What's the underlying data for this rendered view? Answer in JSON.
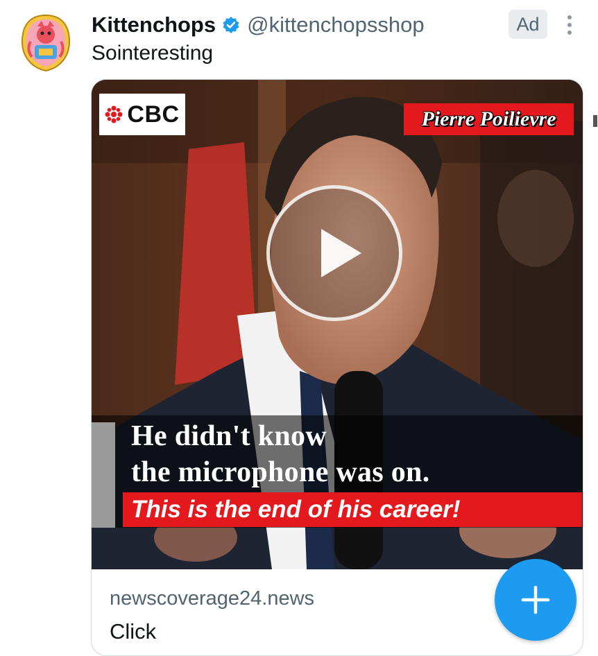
{
  "tweet": {
    "author": {
      "display_name": "Kittenchops",
      "handle": "@kittenchopsshop",
      "verified_icon": "verified-badge-icon",
      "avatar_icon": "avatar-icon"
    },
    "ad_label": "Ad",
    "text": "Sointeresting",
    "card": {
      "media": {
        "logo_text": "CBC",
        "name_tag": "Pierre Poilievre",
        "caption_line1": "He didn't know",
        "caption_line2": "the microphone was on.",
        "caption_red": "This is the end of his career!",
        "play_icon": "play-icon"
      },
      "domain": "newscoverage24.news",
      "title": "Click"
    }
  },
  "fab": {
    "icon": "plus-icon"
  },
  "colors": {
    "accent": "#1d9bf0",
    "verified": "#1d9bf0",
    "caption_red": "#e3191e",
    "secondary_text": "#536471"
  }
}
